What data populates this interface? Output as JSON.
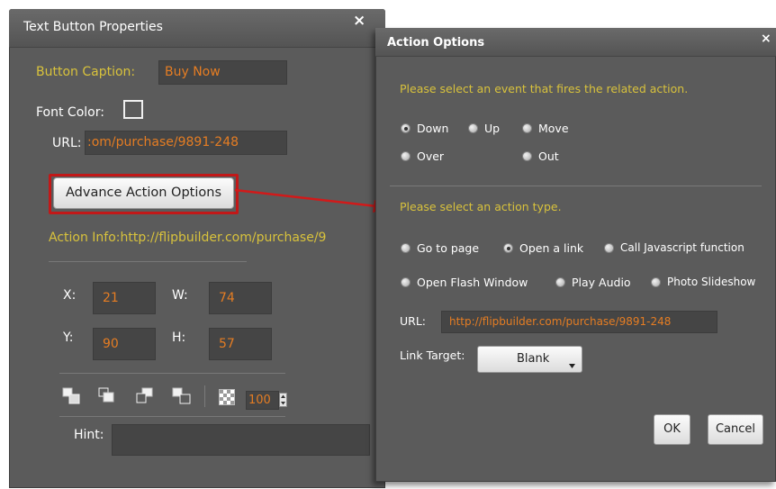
{
  "text_button_properties": {
    "title": "Text Button Properties",
    "close_symbol": "×",
    "button_caption_label": "Button Caption:",
    "button_caption_value": "Buy Now",
    "font_color_label": "Font Color:",
    "url_label": "URL:",
    "url_value": ":om/purchase/9891-248",
    "advance_button_label": "Advance Action Options",
    "action_info_text": "Action Info:http://flipbuilder.com/purchase/9",
    "x_label": "X:",
    "x_value": "21",
    "w_label": "W:",
    "w_value": "74",
    "y_label": "Y:",
    "y_value": "90",
    "h_label": "H:",
    "h_value": "57",
    "opacity_value": "100",
    "hint_label": "Hint:",
    "hint_value": ""
  },
  "action_options": {
    "title": "Action Options",
    "close_symbol": "×",
    "event_prompt": "Please select an event that fires the related action.",
    "events": [
      {
        "label": "Down",
        "checked": true
      },
      {
        "label": "Up",
        "checked": false
      },
      {
        "label": "Move",
        "checked": false
      },
      {
        "label": "Over",
        "checked": false
      },
      {
        "label": "Out",
        "checked": false
      }
    ],
    "action_prompt": "Please select an action type.",
    "action_types": [
      {
        "label": "Go to page",
        "checked": false
      },
      {
        "label": "Open a link",
        "checked": true
      },
      {
        "label": "Call Javascript function",
        "checked": false
      },
      {
        "label": "Open Flash Window",
        "checked": false
      },
      {
        "label": "Play Audio",
        "checked": false
      },
      {
        "label": "Photo Slideshow",
        "checked": false
      }
    ],
    "url_label": "URL:",
    "url_value": "http://flipbuilder.com/purchase/9891-248",
    "link_target_label": "Link Target:",
    "link_target_value": "Blank",
    "ok_label": "OK",
    "cancel_label": "Cancel"
  },
  "colors": {
    "panel_bg": "#5b5b5b",
    "gold_label": "#d8c23c",
    "orange_value": "#e57d23",
    "highlight_red": "#d11a1a"
  }
}
